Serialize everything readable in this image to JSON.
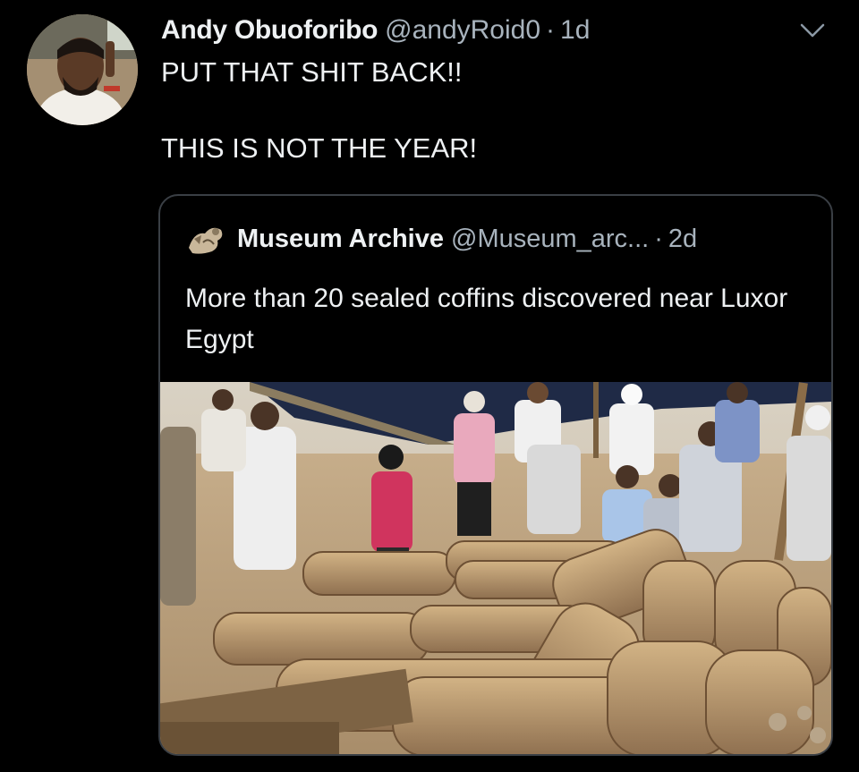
{
  "tweet": {
    "author_name": "Andy Obuoforibo",
    "author_handle": "@andyRoid0",
    "separator": "·",
    "timestamp": "1d",
    "text_line1": "PUT THAT SHIT BACK!!",
    "text_line2": "THIS IS NOT THE YEAR!",
    "menu_icon": "chevron-down-icon"
  },
  "quoted": {
    "author_name": "Museum Archive",
    "author_handle": "@Museum_arc...",
    "separator": "·",
    "timestamp": "2d",
    "text": "More than 20 sealed coffins discovered near Luxor Egypt"
  },
  "colors": {
    "background": "#000000",
    "primary_text": "#eef1f3",
    "secondary_text": "#a8b3bd",
    "border": "#3a3f45"
  }
}
